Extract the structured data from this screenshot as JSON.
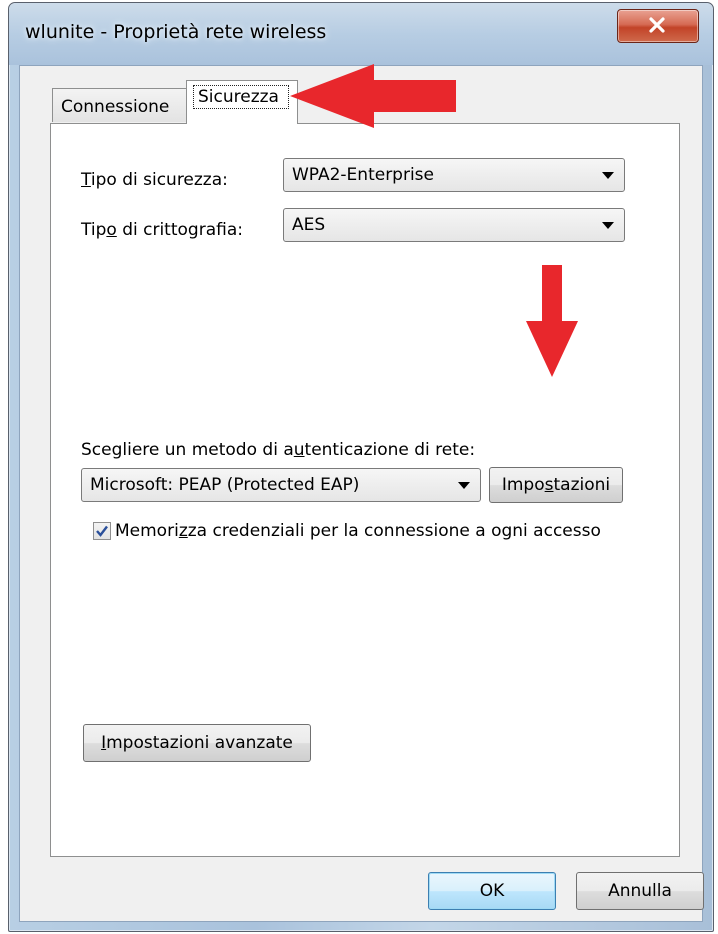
{
  "window": {
    "title": "wlunite - Proprietà rete wireless",
    "close_icon": "close-x-icon"
  },
  "tabs": [
    {
      "label": "Connessione",
      "active": false
    },
    {
      "label": "Sicurezza",
      "active": true
    }
  ],
  "security": {
    "type_label_underline": "T",
    "type_label_rest": "ipo di sicurezza:",
    "type_value": "WPA2-Enterprise",
    "encryption_label_pre": "Tip",
    "encryption_label_underline": "o",
    "encryption_label_post": " di crittografia:",
    "encryption_value": "AES"
  },
  "auth": {
    "label_pre": "Scegliere un metodo di a",
    "label_underline": "u",
    "label_post": "tenticazione di rete:",
    "method_value": "Microsoft: PEAP (Protected EAP)",
    "settings_button_pre": "Impo",
    "settings_button_underline": "s",
    "settings_button_post": "tazioni",
    "remember_label_pre": "Memori",
    "remember_label_underline": "z",
    "remember_label_post": "za credenziali per la connessione a ogni accesso",
    "remember_checked": true
  },
  "advanced": {
    "button_underline": "I",
    "button_rest": "mpostazioni avanzate"
  },
  "footer": {
    "ok_label": "OK",
    "cancel_label": "Annulla"
  },
  "colors": {
    "annotation_arrow": "#e8272c",
    "window_frame": "#aac2dc",
    "close_button": "#c94c30",
    "default_button": "#bee6fd"
  }
}
